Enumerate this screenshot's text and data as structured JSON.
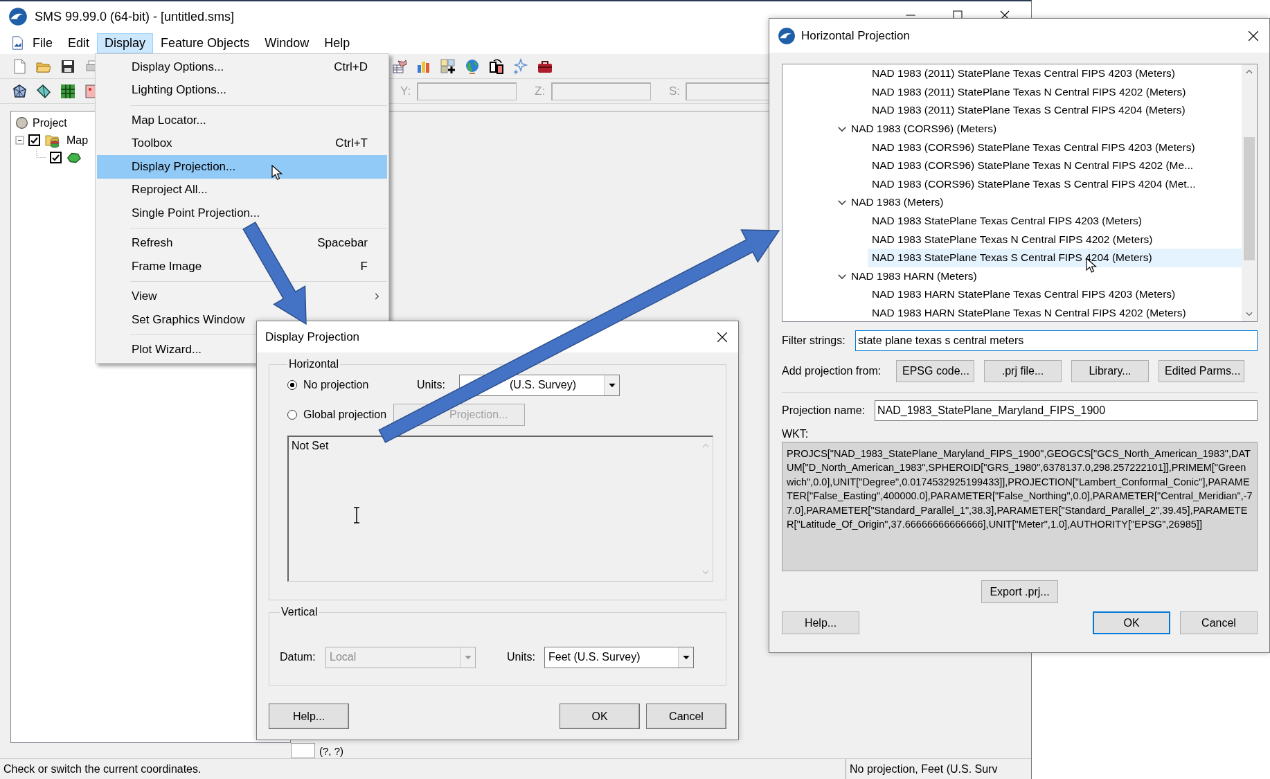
{
  "main_window": {
    "title": "SMS 99.99.0 (64-bit) - [untitled.sms]",
    "menu_bar": [
      {
        "label": "File",
        "selected": false
      },
      {
        "label": "Edit",
        "selected": false
      },
      {
        "label": "Display",
        "selected": true
      },
      {
        "label": "Feature Objects",
        "selected": false
      },
      {
        "label": "Window",
        "selected": false
      },
      {
        "label": "Help",
        "selected": false
      }
    ],
    "toolbar_fields": [
      {
        "label": "Y:",
        "disabled": true
      },
      {
        "label": "Z:",
        "disabled": true
      },
      {
        "label": "S:",
        "disabled": true
      }
    ],
    "project_tree": [
      {
        "label": "Project",
        "children": [
          {
            "label": "Map",
            "expanded": true,
            "checked": true,
            "children": [
              {
                "checked": true
              }
            ]
          }
        ]
      }
    ],
    "coordinates": "(?, ?)",
    "status_bar": {
      "message": "Check or switch the current coordinates.",
      "projection": "No projection, Feet (U.S. Surv"
    }
  },
  "display_menu": {
    "sections": [
      [
        {
          "label": "Display Options...",
          "shortcut": "Ctrl+D",
          "selected": false,
          "has_submenu": false
        },
        {
          "label": "Lighting Options...",
          "selected": false,
          "has_submenu": false
        }
      ],
      [
        {
          "label": "Map Locator...",
          "selected": false,
          "has_submenu": false
        },
        {
          "label": "Toolbox",
          "shortcut": "Ctrl+T",
          "selected": false,
          "has_submenu": false
        },
        {
          "label": "Display Projection...",
          "selected": true,
          "has_submenu": false
        },
        {
          "label": "Reproject All...",
          "selected": false,
          "has_submenu": false
        },
        {
          "label": "Single Point Projection...",
          "selected": false,
          "has_submenu": false
        }
      ],
      [
        {
          "label": "Refresh",
          "shortcut": "Spacebar",
          "selected": false,
          "has_submenu": false
        },
        {
          "label": "Frame Image",
          "shortcut": "F",
          "selected": false,
          "has_submenu": false
        }
      ],
      [
        {
          "label": "View",
          "selected": false,
          "has_submenu": true
        },
        {
          "label": "Set Graphics Window",
          "selected": false,
          "has_submenu": false
        }
      ],
      [
        {
          "label": "Plot Wizard...",
          "selected": false,
          "has_submenu": false
        }
      ]
    ]
  },
  "display_projection_dialog": {
    "title": "Display Projection",
    "horizontal": {
      "legend": "Horizontal",
      "options": [
        {
          "label": "No projection",
          "selected": true
        },
        {
          "label": "Global projection",
          "selected": false
        }
      ],
      "units_label": "Units:",
      "units": {
        "value": "(U.S. Survey)",
        "disabled": false
      },
      "select_button": {
        "label": "Projection...",
        "disabled": true
      },
      "description": "Not Set"
    },
    "vertical": {
      "legend": "Vertical",
      "datum_label": "Datum:",
      "datum": {
        "value": "Local",
        "disabled": true
      },
      "units_label": "Units:",
      "units": {
        "value": "Feet (U.S. Survey)",
        "disabled": false
      }
    },
    "buttons": [
      {
        "label": "Help..."
      },
      {
        "label": "OK"
      },
      {
        "label": "Cancel"
      }
    ]
  },
  "horizontal_projection_dialog": {
    "title": "Horizontal Projection",
    "tree": [
      {
        "children": [
          {
            "label": "NAD 1983 (2011) StatePlane Texas Central FIPS 4203 (Meters)",
            "selected": false
          },
          {
            "label": "NAD 1983 (2011) StatePlane Texas N Central FIPS 4202 (Meters)",
            "selected": false
          },
          {
            "label": "NAD 1983 (2011) StatePlane Texas S Central FIPS 4204 (Meters)",
            "selected": false
          }
        ]
      },
      {
        "label": "NAD 1983 (CORS96) (Meters)",
        "expanded": true,
        "selected": false,
        "children": [
          {
            "label": "NAD 1983 (CORS96) StatePlane Texas Central FIPS 4203 (Meters)",
            "selected": false
          },
          {
            "label": "NAD 1983 (CORS96) StatePlane Texas N Central FIPS 4202 (Me...",
            "selected": false
          },
          {
            "label": "NAD 1983 (CORS96) StatePlane Texas S Central FIPS 4204 (Met...",
            "selected": false
          }
        ]
      },
      {
        "label": "NAD 1983 (Meters)",
        "expanded": true,
        "selected": false,
        "children": [
          {
            "label": "NAD 1983 StatePlane Texas Central FIPS 4203 (Meters)",
            "selected": false
          },
          {
            "label": "NAD 1983 StatePlane Texas N Central FIPS 4202 (Meters)",
            "selected": false
          },
          {
            "label": "NAD 1983 StatePlane Texas S Central FIPS 4204 (Meters)",
            "selected": true
          }
        ]
      },
      {
        "label": "NAD 1983 HARN (Meters)",
        "expanded": true,
        "selected": false,
        "children": [
          {
            "label": "NAD 1983 HARN StatePlane Texas Central FIPS 4203 (Meters)",
            "selected": false
          },
          {
            "label": "NAD 1983 HARN StatePlane Texas N Central FIPS 4202 (Meters)",
            "selected": false
          }
        ]
      }
    ],
    "filter": {
      "label": "Filter strings:",
      "value": "state plane texas s central meters",
      "focused": true
    },
    "add_from": {
      "label": "Add projection from:",
      "buttons": [
        "EPSG code...",
        ".prj file...",
        "Library...",
        "Edited Parms..."
      ]
    },
    "projection_name": {
      "label": "Projection name:",
      "value": "NAD_1983_StatePlane_Maryland_FIPS_1900"
    },
    "wkt": {
      "label": "WKT:",
      "text": "PROJCS[\"NAD_1983_StatePlane_Maryland_FIPS_1900\",GEOGCS[\"GCS_North_American_1983\",DATUM[\"D_North_American_1983\",SPHEROID[\"GRS_1980\",6378137.0,298.257222101]],PRIMEM[\"Greenwich\",0.0],UNIT[\"Degree\",0.0174532925199433]],PROJECTION[\"Lambert_Conformal_Conic\"],PARAMETER[\"False_Easting\",400000.0],PARAMETER[\"False_Northing\",0.0],PARAMETER[\"Central_Meridian\",-77.0],PARAMETER[\"Standard_Parallel_1\",38.3],PARAMETER[\"Standard_Parallel_2\",39.45],PARAMETER[\"Latitude_Of_Origin\",37.66666666666666],UNIT[\"Meter\",1.0],AUTHORITY[\"EPSG\",26985]]"
    },
    "export_button": "Export .prj...",
    "buttons": [
      {
        "label": "Help...",
        "default": false
      },
      {
        "label": "OK",
        "default": true
      },
      {
        "label": "Cancel",
        "default": false
      }
    ]
  }
}
